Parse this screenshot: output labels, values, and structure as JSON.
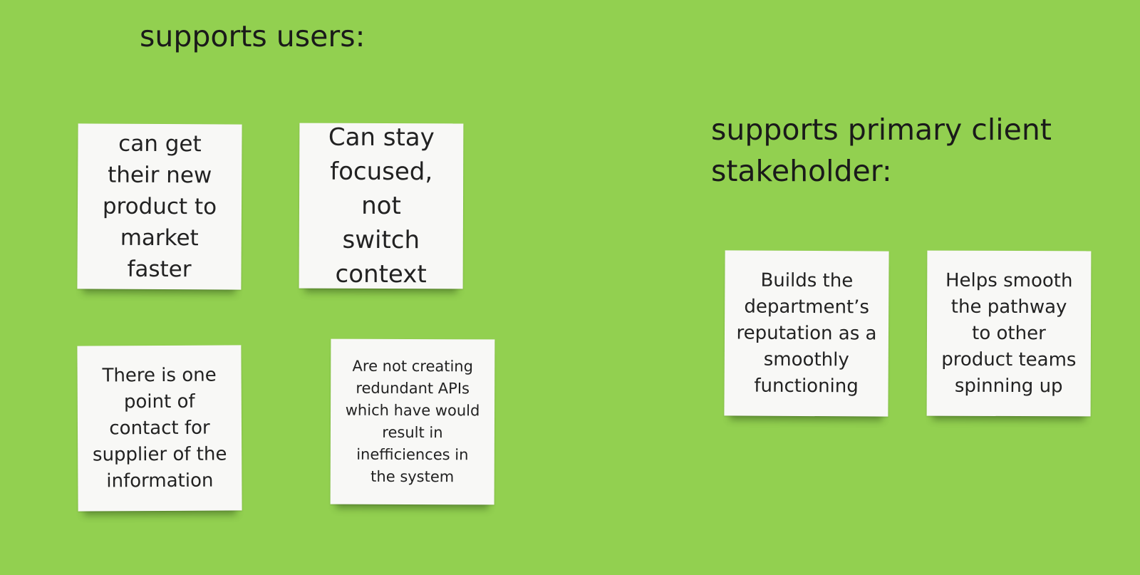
{
  "headings": {
    "users": "supports users:",
    "stakeholder_line1": "supports primary client",
    "stakeholder_line2": "stakeholder:"
  },
  "notes": {
    "n1": "can get their new product to market faster",
    "n2": "Can stay focused, not switch context",
    "n3": "There is one point of contact for supplier of the information",
    "n4": "Are not creating redundant APIs which have would result in inefficiences in the system",
    "n5": "Builds the department’s reputation as a smoothly functioning",
    "n6": "Helps smooth the pathway to other product teams spinning up"
  },
  "colors": {
    "board_background": "#92d050",
    "sticky_note": "#f8f8f6",
    "text": "#1a1a1a"
  }
}
